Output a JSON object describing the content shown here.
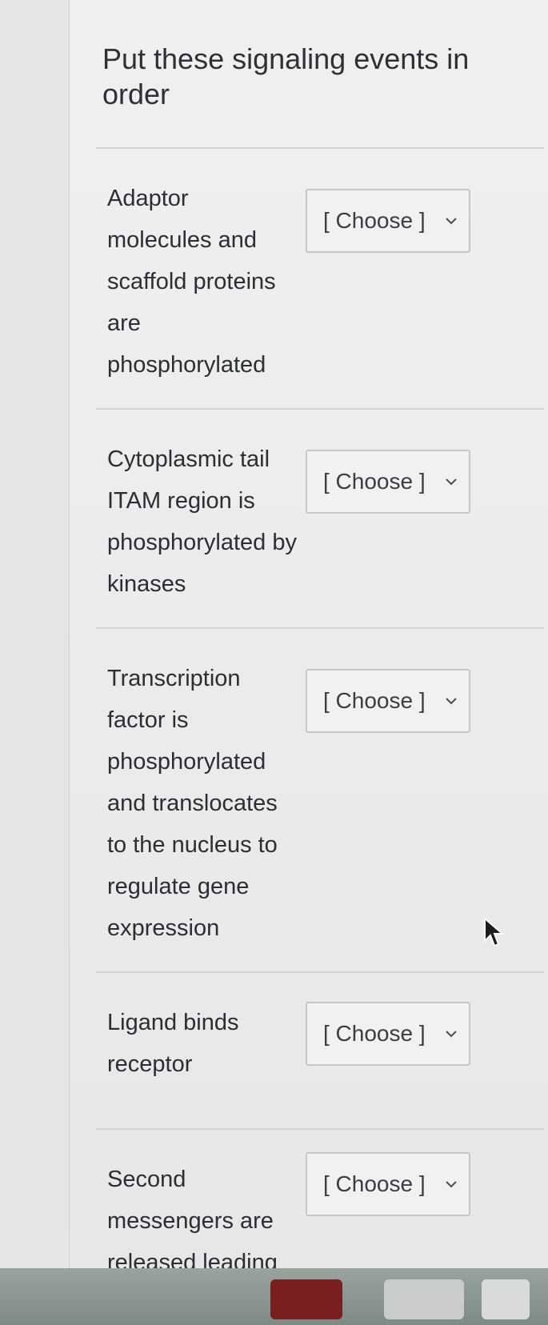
{
  "question": {
    "title": "Put these signaling events in order"
  },
  "items": [
    {
      "label": "Adaptor molecules and scaffold proteins are phosphorylated",
      "selected": "[ Choose ]"
    },
    {
      "label": "Cytoplasmic tail ITAM region is phosphorylated by kinases",
      "selected": "[ Choose ]"
    },
    {
      "label": "Transcription factor is phosphorylated and translocates to the nucleus to regulate gene expression",
      "selected": "[ Choose ]"
    },
    {
      "label": "Ligand binds receptor",
      "selected": "[ Choose ]"
    },
    {
      "label": "Second messengers are released leading to additional phosphorylation",
      "selected": "[ Choose ]"
    }
  ],
  "icons": {
    "dropdown": "chevron-down-icon",
    "pointer": "mouse-pointer-icon"
  },
  "colors": {
    "background": "#eef0f1",
    "text": "#2a2d31",
    "border": "#c4c8cb"
  }
}
